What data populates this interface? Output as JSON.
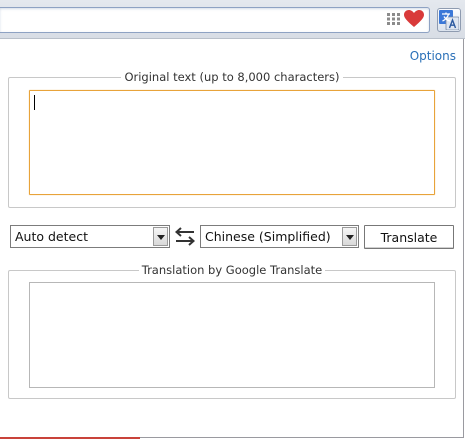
{
  "toolbar": {
    "icons": [
      "apps-icon",
      "heart-icon",
      "translate-extension-icon"
    ],
    "heart_color": "#d93a3a",
    "translate_icon_color": "#3b78d8"
  },
  "popup": {
    "options_label": "Options",
    "source_legend": "Original text (up to 8,000 characters)",
    "source_text": "",
    "source_language": "Auto detect",
    "target_language": "Chinese (Simplified)",
    "translate_label": "Translate",
    "result_legend": "Translation by Google Translate",
    "result_text": ""
  },
  "colors": {
    "link": "#2a70b8",
    "focus_border": "#e8a33a"
  }
}
